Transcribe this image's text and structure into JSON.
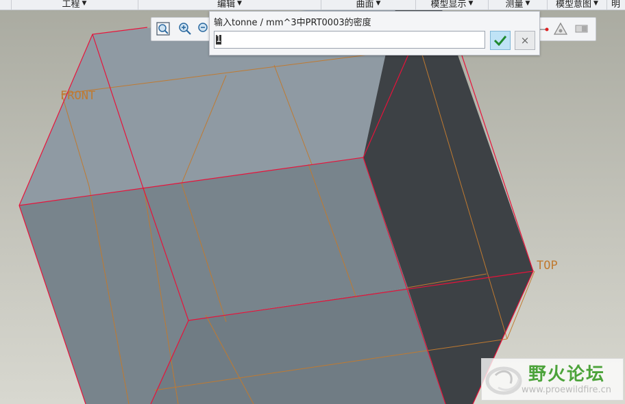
{
  "menu": {
    "items": [
      {
        "label": "工程"
      },
      {
        "label": "编辑"
      },
      {
        "label": "曲面"
      },
      {
        "label": "模型显示"
      },
      {
        "label": "测量"
      },
      {
        "label": "模型意图"
      },
      {
        "label": "明"
      }
    ]
  },
  "viewport": {
    "datum_labels": {
      "front": "FRONT",
      "top": "TOP"
    },
    "colors": {
      "face_top": "#8f9aa3",
      "face_front": "#78848c",
      "face_side": "#3d4145",
      "edge": "#e8123a",
      "datum": "#c07a30"
    }
  },
  "toolbar": {
    "icons": [
      "zoom-fit-icon",
      "zoom-in-icon",
      "zoom-out-icon",
      "datum-point-icon",
      "triangle-display-icon",
      "plane-display-icon"
    ]
  },
  "dialog": {
    "prompt": "输入tonne / mm^3中PRT0003的密度",
    "value": "1",
    "ok_icon": "checkmark-icon",
    "cancel_icon": "close-icon",
    "cancel_glyph": "×"
  },
  "watermark": {
    "brand": "野火论坛",
    "url": "www.proewildfire.cn",
    "color": "#4ca33a"
  }
}
